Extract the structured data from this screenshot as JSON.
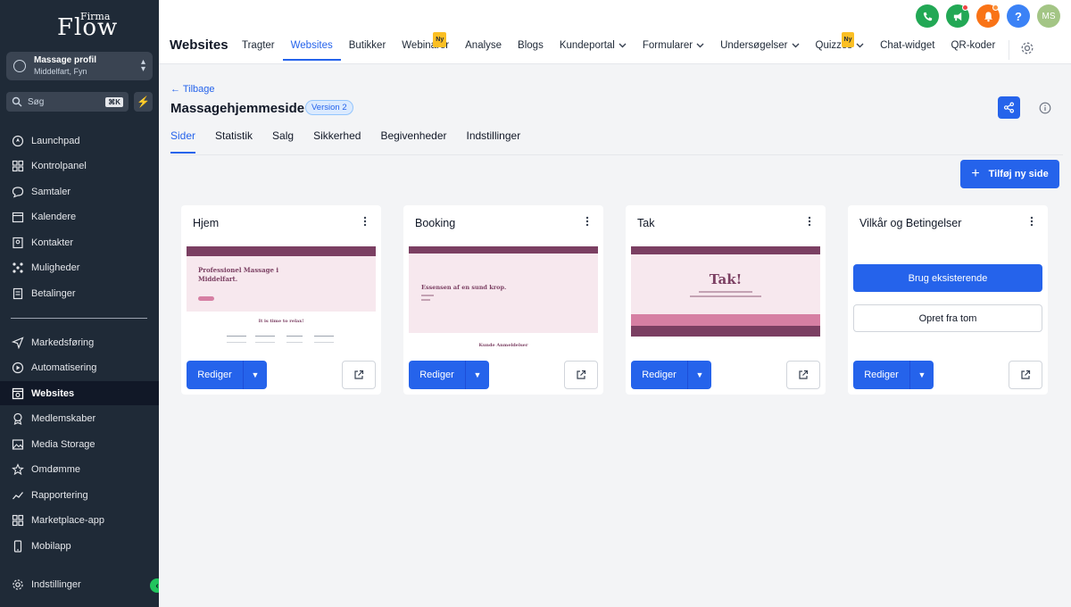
{
  "brand": {
    "logo_word": "Flow",
    "logo_sup": "Firma"
  },
  "account": {
    "name": "Massage profil",
    "location": "Middelfart, Fyn"
  },
  "search": {
    "placeholder": "Søg",
    "shortcut": "⌘K"
  },
  "sidebar": {
    "items": [
      {
        "label": "Launchpad",
        "icon": "rocket-icon"
      },
      {
        "label": "Kontrolpanel",
        "icon": "dashboard-icon"
      },
      {
        "label": "Samtaler",
        "icon": "chat-icon"
      },
      {
        "label": "Kalendere",
        "icon": "calendar-icon"
      },
      {
        "label": "Kontakter",
        "icon": "contacts-icon"
      },
      {
        "label": "Muligheder",
        "icon": "pipeline-icon"
      },
      {
        "label": "Betalinger",
        "icon": "payments-icon"
      },
      {
        "label": "Markedsføring",
        "icon": "send-icon"
      },
      {
        "label": "Automatisering",
        "icon": "automation-icon"
      },
      {
        "label": "Websites",
        "icon": "website-icon",
        "active": true
      },
      {
        "label": "Medlemskaber",
        "icon": "membership-icon"
      },
      {
        "label": "Media Storage",
        "icon": "image-icon"
      },
      {
        "label": "Omdømme",
        "icon": "star-icon"
      },
      {
        "label": "Rapportering",
        "icon": "chart-icon"
      },
      {
        "label": "Marketplace-app",
        "icon": "apps-icon"
      },
      {
        "label": "Mobilapp",
        "icon": "mobile-icon"
      }
    ],
    "settings_label": "Indstillinger"
  },
  "header": {
    "title": "Websites",
    "tabs": [
      {
        "label": "Tragter"
      },
      {
        "label": "Websites",
        "active": true
      },
      {
        "label": "Butikker"
      },
      {
        "label": "Webinarer",
        "badge": "Ny"
      },
      {
        "label": "Analyse"
      },
      {
        "label": "Blogs"
      },
      {
        "label": "Kundeportal",
        "dropdown": true
      },
      {
        "label": "Formularer",
        "dropdown": true
      },
      {
        "label": "Undersøgelser",
        "dropdown": true
      },
      {
        "label": "Quizzes",
        "dropdown": true,
        "badge": "Ny"
      },
      {
        "label": "Chat-widget"
      },
      {
        "label": "QR-koder"
      }
    ],
    "avatar_initials": "MS",
    "help_label": "?"
  },
  "site": {
    "back_label": "← Tilbage",
    "title": "Massagehjemmeside",
    "version": "Version 2",
    "subtabs": [
      "Sider",
      "Statistik",
      "Salg",
      "Sikkerhed",
      "Begivenheder",
      "Indstillinger"
    ]
  },
  "actions": {
    "add_page": "Tilføj ny side",
    "add_icon": "+"
  },
  "pages": [
    {
      "title": "Hjem",
      "edit": "Rediger",
      "thumb_heading": "Professionel Massage i Middelfart.",
      "thumb_sub": "It is time to relax!"
    },
    {
      "title": "Booking",
      "edit": "Rediger",
      "thumb_heading": "Essensen af en sund krop.",
      "thumb_sub": "Kunde Anmeldelser"
    },
    {
      "title": "Tak",
      "edit": "Rediger",
      "thumb_heading": "Tak!"
    },
    {
      "title": "Vilkår og Betingelser",
      "use_existing": "Brug eksisterende",
      "create_new": "Opret fra tom",
      "edit": "Rediger"
    }
  ],
  "colors": {
    "accent": "#2563eb",
    "sidebar": "#1f2a37",
    "thumb_header": "#7b3f62",
    "thumb_bg": "#f7e8ee",
    "thumb_band": "#d67fa3"
  }
}
